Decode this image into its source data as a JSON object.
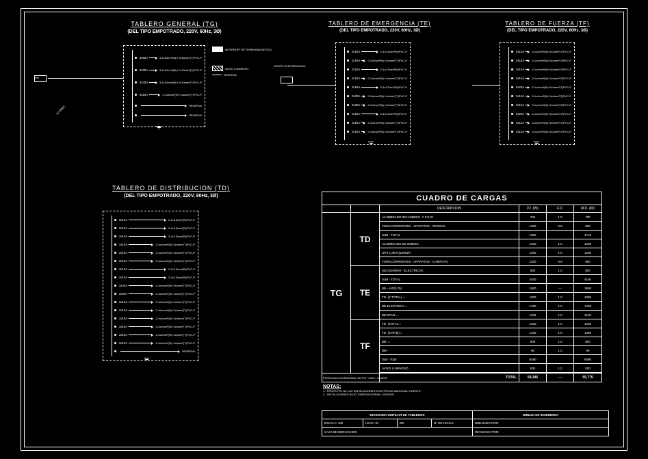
{
  "panels": {
    "tg": {
      "title": "TABLERO GENERAL (TG)",
      "subtitle": "(DEL TIPO EMPOTRADO, 220V, 60Hz, 3Ø)",
      "circuits": [
        {
          "id": "C-1",
          "label": "3x50A",
          "desc": "3-1x16mm²(N)+1x16mm²(T)PVC-P"
        },
        {
          "id": "C-2",
          "label": "3x30A",
          "desc": "3-1x10mm²(N)+1x10mm²(T)PVC-P"
        },
        {
          "id": "C-3",
          "label": "3x30A",
          "desc": "3-1x10mm²(N)+1x10mm²(T)PVC-P"
        },
        {
          "id": "C-4",
          "label": "3x15A",
          "desc": "3-1x6mm²(N)+1x6mm²(T)PVC-P"
        }
      ],
      "reserve": "RESERVA",
      "feed_label": "ACOMET.",
      "meter": "Wh",
      "legend": [
        {
          "sym": "solid",
          "text": "INTERRUPTOR TERMOMAGNETICO"
        },
        {
          "sym": "hatch",
          "text": "AVISO LUMINOSO"
        },
        {
          "sym": "line",
          "text": "RESERVA"
        }
      ]
    },
    "te": {
      "title": "TABLERO DE EMERGENCIA (TE)",
      "subtitle": "(DEL TIPO EMPOTRADO, 220V, 60Hz, 3Ø)",
      "circuits": [
        {
          "id": "C-1",
          "label": "2x15A",
          "desc": "2-1x2.5mm²(N)PVC-P"
        },
        {
          "id": "C-2",
          "label": "2x15A",
          "desc": "2-1x4mm²(N)+1x4mm²(T)PVC-P"
        },
        {
          "id": "C-3",
          "label": "2x15A",
          "desc": "2-1x2.5mm²(N)PVC-P"
        },
        {
          "id": "C-4",
          "label": "2x15A",
          "desc": "2-1x4mm²(N)+1x4mm²(T)PVC-P"
        },
        {
          "id": "C-5",
          "label": "2x15A",
          "desc": "2-1x2.5mm²(N)PVC-P"
        },
        {
          "id": "C-6",
          "label": "2x20A",
          "desc": "2-1x4mm²(N)+1x4mm²(T)PVC-P"
        },
        {
          "id": "C-7",
          "label": "2x20A",
          "desc": "2-1x4mm²(N)+1x4mm²(T)PVC-P"
        },
        {
          "id": "C-8",
          "label": "2x15A",
          "desc": "2-1x2.5mm²(N)PVC-P"
        },
        {
          "id": "C-9",
          "label": "2x15A",
          "desc": "2-1x4mm²(N)+1x4mm²(T)PVC-P"
        },
        {
          "id": "C-10",
          "label": "2x15A",
          "desc": "2-1x4mm²(N)+1x4mm²(T)PVC-P"
        }
      ],
      "gen": "GRUPO ELECTROGENO"
    },
    "tf": {
      "title": "TABLERO DE FUERZA (TF)",
      "subtitle": "(DEL TIPO EMPOTRADO, 220V, 60Hz, 3Ø)",
      "circuits": [
        {
          "id": "C-1",
          "label": "3x15A",
          "desc": "3-1x4mm²(N)+1x4mm²(T)PVC-P"
        },
        {
          "id": "C-2",
          "label": "3x15A",
          "desc": "3-1x4mm²(N)+1x4mm²(T)PVC-P"
        },
        {
          "id": "C-3",
          "label": "3x15A",
          "desc": "3-1x4mm²(N)+1x4mm²(T)PVC-P"
        },
        {
          "id": "C-4",
          "label": "3x15A",
          "desc": "3-1x4mm²(N)+1x4mm²(T)PVC-P"
        },
        {
          "id": "C-5",
          "label": "3x20A",
          "desc": "3-1x4mm²(N)+1x4mm²(T)PVC-P"
        },
        {
          "id": "C-6",
          "label": "3x15A",
          "desc": "3-1x4mm²(N)+1x4mm²(T)PVC-P"
        },
        {
          "id": "C-7",
          "label": "3x15A",
          "desc": "3-1x4mm²(N)+1x4mm²(T)PVC-P"
        },
        {
          "id": "C-8",
          "label": "3x20A",
          "desc": "3-1x4mm²(N)+1x4mm²(T)PVC-P"
        },
        {
          "id": "C-9",
          "label": "3x15A",
          "desc": "3-1x4mm²(N)+1x4mm²(T)PVC-P"
        },
        {
          "id": "C-10",
          "label": "3x15A",
          "desc": "3-1x4mm²(N)+1x4mm²(T)PVC-P"
        }
      ]
    },
    "td": {
      "title": "TABLERO DE DISTRIBUCION (TD)",
      "subtitle": "(DEL TIPO EMPOTRADO, 220V, 60Hz, 3Ø)",
      "circuits": [
        {
          "id": "C-1",
          "label": "2x15A",
          "desc": "2-1x2.5mm²(N)PVC-P"
        },
        {
          "id": "C-2",
          "label": "2x15A",
          "desc": "2-1x2.5mm²(N)PVC-P"
        },
        {
          "id": "C-3",
          "label": "2x15A",
          "desc": "2-1x2.5mm²(N)PVC-P"
        },
        {
          "id": "C-4",
          "label": "2x15A",
          "desc": "2-1x4mm²(N)+1x4mm²(T)PVC-P"
        },
        {
          "id": "C-5",
          "label": "2x15A",
          "desc": "2-1x4mm²(N)+1x4mm²(T)PVC-P"
        },
        {
          "id": "C-6",
          "label": "2x15A",
          "desc": "2-1x4mm²(N)+1x4mm²(T)PVC-P"
        },
        {
          "id": "C-7",
          "label": "2x15A",
          "desc": "2-1x2.5mm²(N)PVC-P"
        },
        {
          "id": "C-8",
          "label": "2x15A",
          "desc": "2-1x2.5mm²(N)PVC-P"
        },
        {
          "id": "C-9",
          "label": "2x20A",
          "desc": "2-1x4mm²(N)+1x4mm²(T)PVC-P"
        },
        {
          "id": "C-10",
          "label": "2x20A",
          "desc": "2-1x4mm²(N)+1x4mm²(T)PVC-P"
        },
        {
          "id": "C-11",
          "label": "2x15A",
          "desc": "2-1x4mm²(N)+1x4mm²(T)PVC-P"
        },
        {
          "id": "C-12",
          "label": "2x15A",
          "desc": "2-1x4mm²(N)+1x4mm²(T)PVC-P"
        },
        {
          "id": "C-13",
          "label": "2x15A",
          "desc": "2-1x4mm²(N)+1x4mm²(T)PVC-P"
        },
        {
          "id": "C-14",
          "label": "2x15A",
          "desc": "2-1x4mm²(N)+1x4mm²(T)PVC-P"
        },
        {
          "id": "C-15",
          "label": "2x15A",
          "desc": "2-1x4mm²(N)+1x4mm²(T)PVC-P"
        },
        {
          "id": "C-16",
          "label": "2x15A",
          "desc": "2-1x4mm²(N)+1x4mm²(T)PVC-P"
        },
        {
          "id": "C-17",
          "label": "",
          "desc": "RESERVA"
        }
      ]
    }
  },
  "load_table": {
    "title": "CUADRO DE CARGAS",
    "headers": [
      "DESCRIPCION",
      "P.I. (W)",
      "F.D.",
      "M.D. (W)"
    ],
    "tg_label": "TG",
    "sections": [
      {
        "label": "TD",
        "rows": [
          {
            "desc": "ALUMBRADO INCANDESC. Y FLUO",
            "pi": "750",
            "fd": "1.0",
            "md": "750"
          },
          {
            "desc": "TOMACORRIENTES - APARATOS - TERMAS",
            "pi": "1200",
            "fd": "0.8",
            "md": "960"
          },
          {
            "desc": "SUB - TOTAL",
            "pi": "1950",
            "fd": "",
            "md": "1710"
          }
        ]
      },
      {
        "label": "TE",
        "rows": [
          {
            "desc": "ALUMBRADO DE EMERG.",
            "pi": "1200",
            "fd": "1.0",
            "md": "1200"
          },
          {
            "desc": "UPS 1.5kVA(1200W)",
            "pi": "1200",
            "fd": "1.0",
            "md": "1200"
          },
          {
            "desc": "TOMACORRIENTES - APARATOS - COMPUTO",
            "pi": "1200",
            "fd": "0.8",
            "md": "960"
          },
          {
            "desc": "SECADORAS - ELECTRICAS",
            "pi": "800",
            "fd": "1.0",
            "md": "800"
          },
          {
            "desc": "SUB - TOTAL",
            "pi": "4400",
            "fd": "",
            "md": "4160"
          }
        ]
      },
      {
        "label": "TF",
        "rows": [
          {
            "desc": "BB = HP(0.75)",
            "pi": "1500",
            "fd": "—",
            "md": "1500"
          },
          {
            "desc": "TD- (2 TOTAL) =",
            "pi": "1000",
            "fd": "1.0",
            "md": "1000"
          },
          {
            "desc": "BB-ELECTRICA =",
            "pi": "1400",
            "fd": "1.0",
            "md": "1400"
          },
          {
            "desc": "BB-STAN =",
            "pi": "1100",
            "fd": "1.0",
            "md": "1100"
          },
          {
            "desc": "TD- (TOTAL =",
            "pi": "1200",
            "fd": "1.0",
            "md": "1200"
          },
          {
            "desc": "TD- (2 KFID) =",
            "pi": "1400",
            "fd": "1.0",
            "md": "1400"
          },
          {
            "desc": "BB- =",
            "pi": "800",
            "fd": "1.0",
            "md": "800"
          },
          {
            "desc": "BB+",
            "pi": "90",
            "fd": "1.0",
            "md": "90"
          },
          {
            "desc": "Sub - Total",
            "pi": "8490",
            "fd": "",
            "md": "8490"
          },
          {
            "desc": "AVISO LUMINOSO",
            "pi": "500",
            "fd": "1.0",
            "md": "500"
          }
        ]
      }
    ],
    "total": {
      "label_left": "POTENCIA CONTRATADA: 55,775 / 1000 = 55.8KW",
      "label": "TOTAL",
      "pi": "59,345",
      "fd": "—",
      "md": "55,775"
    }
  },
  "notes": {
    "title": "NOTAS:",
    "lines": [
      "1.- PROYECTO DE LAS INSTALACIONES ELECTRICAS NACIONAL VIGENTE.",
      "2.- INSTALACIONES BAJO TUBERIA NORMAL VIGENTE."
    ]
  },
  "titleblock": {
    "drawing": "DIAGRAMA UNIFILAR DE TABLEROS",
    "project": "DIBUJO DE INGENIERIA",
    "cells": {
      "escala": "ESCALA: S/E",
      "hoja": "HOJA: 01",
      "de": "DE:",
      "fecha": "N° DE HOJAS",
      "dibujo": "DIBUJADO POR:",
      "rev": "REVISADO POR:"
    },
    "caja": "CAJA DE DERIVACION"
  }
}
